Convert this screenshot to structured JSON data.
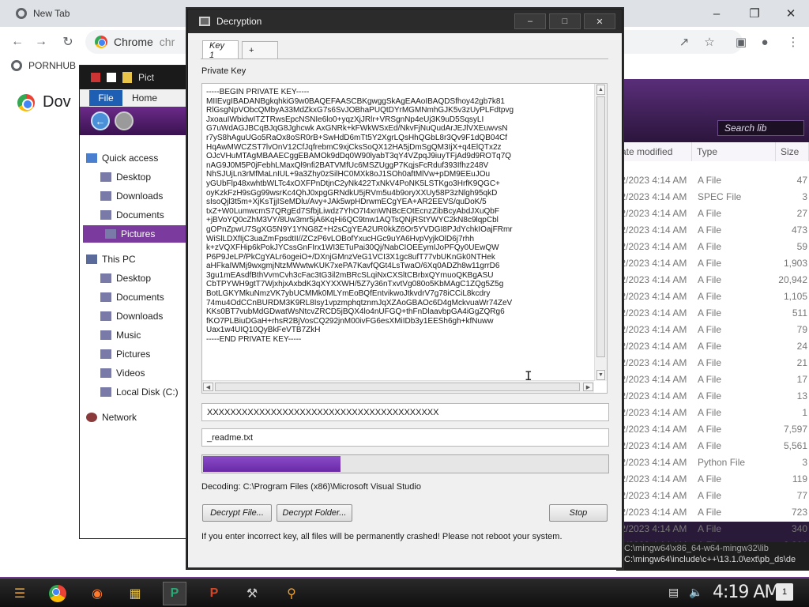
{
  "chrome": {
    "tab_label": "New Tab",
    "address_text": "Chrome",
    "address_suffix": "chr",
    "bookmark_label": "PORNHUB",
    "page_heading": "Dov",
    "icons": [
      "back-icon",
      "forward-icon",
      "reload-icon",
      "share-icon",
      "star-icon",
      "sidebar-icon",
      "profile-icon",
      "menu-icon"
    ]
  },
  "explorer": {
    "title_text": "Pict",
    "ribbon": {
      "file_tab": "File",
      "home_tab": "Home"
    },
    "quick_access": "Quick access",
    "quick_items": [
      "Desktop",
      "Downloads",
      "Documents",
      "Pictures"
    ],
    "this_pc": "This PC",
    "pc_items": [
      "Desktop",
      "Documents",
      "Downloads",
      "Music",
      "Pictures",
      "Videos",
      "Local Disk (C:)"
    ],
    "network": "Network",
    "selected_item": "Pictures"
  },
  "file_pane": {
    "search_placeholder": "Search lib",
    "columns": [
      "ate modified",
      "Type",
      "Size"
    ],
    "rows": [
      {
        "date": "/2/2023 4:14 AM",
        "type": "A File",
        "size": "47"
      },
      {
        "date": "/2/2023 4:14 AM",
        "type": "SPEC File",
        "size": "3"
      },
      {
        "date": "/2/2023 4:14 AM",
        "type": "A File",
        "size": "27"
      },
      {
        "date": "/2/2023 4:14 AM",
        "type": "A File",
        "size": "473"
      },
      {
        "date": "/2/2023 4:14 AM",
        "type": "A File",
        "size": "59"
      },
      {
        "date": "/2/2023 4:14 AM",
        "type": "A File",
        "size": "1,903"
      },
      {
        "date": "/2/2023 4:14 AM",
        "type": "A File",
        "size": "20,942"
      },
      {
        "date": "/2/2023 4:14 AM",
        "type": "A File",
        "size": "1,105"
      },
      {
        "date": "/2/2023 4:14 AM",
        "type": "A File",
        "size": "511"
      },
      {
        "date": "/2/2023 4:14 AM",
        "type": "A File",
        "size": "79"
      },
      {
        "date": "/2/2023 4:14 AM",
        "type": "A File",
        "size": "24"
      },
      {
        "date": "/2/2023 4:14 AM",
        "type": "A File",
        "size": "21"
      },
      {
        "date": "/2/2023 4:14 AM",
        "type": "A File",
        "size": "17"
      },
      {
        "date": "/2/2023 4:14 AM",
        "type": "A File",
        "size": "13"
      },
      {
        "date": "/2/2023 4:14 AM",
        "type": "A File",
        "size": "1"
      },
      {
        "date": "/2/2023 4:14 AM",
        "type": "A File",
        "size": "7,597"
      },
      {
        "date": "/2/2023 4:14 AM",
        "type": "A File",
        "size": "5,561"
      },
      {
        "date": "/2/2023 4:14 AM",
        "type": "Python File",
        "size": "3"
      },
      {
        "date": "/2/2023 4:14 AM",
        "type": "A File",
        "size": "119"
      },
      {
        "date": "/2/2023 4:14 AM",
        "type": "A File",
        "size": "77"
      },
      {
        "date": "/2/2023 4:14 AM",
        "type": "A File",
        "size": "723"
      },
      {
        "date": "/2/2023 4:14 AM",
        "type": "A File",
        "size": "340"
      },
      {
        "date": "/2/2023 4:14 AM",
        "type": "A File",
        "size": "3,300"
      }
    ],
    "cmd_text": "C:\\mingw64\\include\\c++\\13.1.0\\ext\\pb_ds\\de",
    "cmd_text_top": "C:\\mingw64\\x86_64-w64-mingw32\\lib"
  },
  "dialog": {
    "title": "Decryption",
    "tabs": [
      "Key 1",
      "+"
    ],
    "private_key_label": "Private Key",
    "key_lines": [
      "-----BEGIN PRIVATE KEY-----",
      "MIIEvgIBADANBgkqhkiG9w0BAQEFAASCBKgwggSkAgEAAoIBAQDSfhoy42gb7k81",
      "RlGsgNpVObcQMbyA33MdZkxG7s6SvJOBhaPUQtDYrMGMNmhGJK5v3zUyPLFdtpvg",
      "JxoauIWbidwITZTRwsEpcNSNIe6lo0+yqzXjJRlr+VRSgnNp4eUj3K9uD5SqsyLI",
      "G7uWdAGJBCqBJqG8Jghcwk AxGNRk+kFWkWSxEd/NkvFjNuQudArJEJlVXEuwvsN",
      "r7yS8hAguUGo5RaOx8oSR0rB+SwHdD6mTt5Y2XgrLQsHhQGbL8r3Qv9F1dQB04Cf",
      "HqAwMWCZST7lvOnV12CfJqfrebmC9xjCksSoQX12HA5jDmSgQM3IjX+q4ElQTx2z",
      "OJcVHuMTAgMBAAECggEBAMOk9dDq0W90lyabT3qY4VZpqJ9iuyTFjAd9d9ROTq7Q",
      "nAG9J0M5P0jFebhLMaxQl9nfi2BATVMfUc6MSZUggP7KqjsFcRduf393Ifhz248V",
      "NhSJUjLn3rMfMaLnIUL+9a3Zhy0zSilHC0MXk8oJ1SOh0aftMlVw+pDM9EEuJOu",
      "yGUbFlp48xwhtbWLTc4xOXFPnDtjnC2yNk422TxNkV4PoNK5LSTKgo3HrfK9QGC+",
      "oyKzkFzH9sGg99wsrKc4QhJ0xpgGRNdkU5jRVm5u4b9oryXXUy58P3zNlgh95qkD",
      "sIsoQjl3t5m+XjKsTjjISeMDlu/Avy+JAk5wpHDrwmECgYEA+AR2EEVS/quDoK/5",
      "txZ+W0LumwcmS7QRgEd7SfbjLiwdz7YhO7I4xnWNBcEOtEcnzZibBcyAbdJXuQbF",
      "+jBVoYQ0cZhM3VY/8Uw3mr5jA6KqHi6QC9tnw1AQTsQNjRStYWYC2kN8c9lqpCbl",
      "gOPnZpwU7SgXG5N9Y1YNG8Z+H2sCgYEA2UR0kkZ6Or5YVDGI8PJdYchkIOajFRmr",
      "WiSlLDXfIjC3uaZmFpsdtII//ZCzP6vLOBofYxucHGc9uYA6HvpVyjkOlD6j7rhh",
      "k+zVQXFHip6kPokJYCssGnFIrx1WI3ETuPai30Qj/NabCIOEEymIJoPFQy0UEwQW",
      "P6P9JeLP/PkCgYALr6ogeiO+/DXnjGMnzVeG1VCI3X1gc8ufT77vbUKnGk0NTHek",
      "aHFkaIWMj9wxgmjNtzMWwtwKUK7xePA7KavfQGt4LsTwaO/6Xq0ADZh8w11grrD6",
      "3gu1mEAsdfBthVvmCvh3cFac3tG3il2mBRcSLqiNxCXSltCBrbxQYrnuoQKBgASU",
      "CbTPYWH9gtT7WjxhjxAxbdK3qXYXXWH/5Z7y36nTxvtVg080o5KbMAgC1ZQg5Z5g",
      "BotLGKYMkuNmzVK7ybUCMMk0MLYmEoBQfEntvikwoJtkvdrV7g78iCCiL8kcdry",
      "74mu4OdCCnBURDM3K9RL8Isy1vpzmphqtznmJqXZAoGBAOc6D4gMckvuaWr74ZeV",
      "KKs0BT7vubMdGDwatWsNtcvZRCD5jBQX4lo4nUFGQ+thFnDlaavbpGA4iGgZQRg6",
      "fKO7PLBiuDGaH+rhsR2BjVosCQ292jnM00ivFG6esXMiIDb3y1EESh6gh+kfNuww",
      "Uax1w4UIQ10QyBkFeVTB7ZkH",
      "-----END PRIVATE KEY-----"
    ],
    "id_field": "XXXXXXXXXXXXXXXXXXXXXXXXXXXXXXXXXXXXXXXX",
    "readme_field": "_readme.txt",
    "progress_fraction": 0.34,
    "decoding_status": "Decoding: C:\\Program Files (x86)\\Microsoft Visual Studio",
    "buttons": {
      "decrypt_file": "Decrypt File...",
      "decrypt_folder": "Decrypt Folder...",
      "stop": "Stop"
    },
    "warning": "If you enter incorrect key, all files will be permanently crashed! Please not reboot your system.",
    "window_buttons": {
      "minimize": "–",
      "maximize": "□",
      "close": "✕"
    }
  },
  "taskbar": {
    "clock": "4:19 AM",
    "notification_count": "1",
    "apps": [
      "start-button",
      "chrome-app",
      "firefox-app",
      "file-explorer-app",
      "publisher-app",
      "powerpoint-app",
      "tools-app",
      "search-app"
    ],
    "accent_color": "#6d3a8d"
  }
}
